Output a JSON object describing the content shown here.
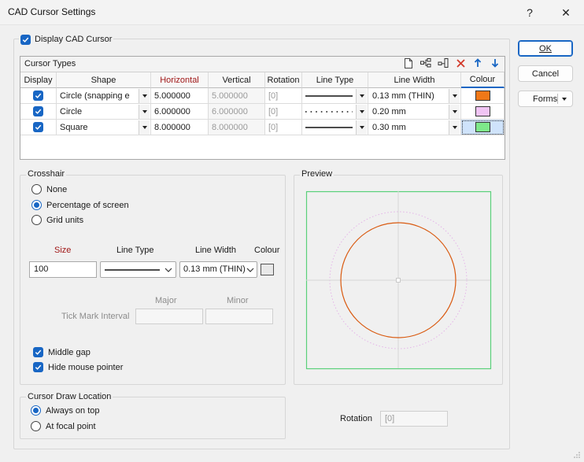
{
  "window": {
    "title": "CAD Cursor Settings",
    "help": "?",
    "close": "✕"
  },
  "display_cad_cursor": {
    "label": "Display CAD Cursor",
    "checked": true
  },
  "cursor_types": {
    "title": "Cursor Types",
    "columns": [
      "Display",
      "Shape",
      "Horizontal",
      "Vertical",
      "Rotation",
      "Line Type",
      "Line Width",
      "Colour"
    ],
    "rows": [
      {
        "display": true,
        "shape": "Circle (snapping e",
        "horizontal": "5.000000",
        "vertical": "5.000000",
        "rotation": "[0]",
        "line_type": "solid",
        "line_width": "0.13 mm (THIN)",
        "colour": "#f07818"
      },
      {
        "display": true,
        "shape": "Circle",
        "horizontal": "6.000000",
        "vertical": "6.000000",
        "rotation": "[0]",
        "line_type": "dotted",
        "line_width": "0.20 mm",
        "colour": "#f0c4f4"
      },
      {
        "display": true,
        "shape": "Square",
        "horizontal": "8.000000",
        "vertical": "8.000000",
        "rotation": "[0]",
        "line_type": "solid",
        "line_width": "0.30 mm",
        "colour": "#7ee88a"
      }
    ]
  },
  "crosshair": {
    "title": "Crosshair",
    "options": [
      "None",
      "Percentage of screen",
      "Grid units"
    ],
    "selected": "Percentage of screen",
    "size_label": "Size",
    "line_type_label": "Line Type",
    "line_width_label": "Line Width",
    "colour_label": "Colour",
    "size_value": "100",
    "line_width_value": "0.13 mm (THIN)",
    "tick_label": "Tick Mark Interval",
    "major_label": "Major",
    "minor_label": "Minor",
    "middle_gap": "Middle gap",
    "hide_mouse": "Hide mouse pointer"
  },
  "draw_location": {
    "title": "Cursor Draw Location",
    "options": [
      "Always on top",
      "At focal point"
    ],
    "selected": "Always on top"
  },
  "preview": {
    "title": "Preview"
  },
  "rotation": {
    "label": "Rotation",
    "value": "[0]"
  },
  "buttons": {
    "ok": "OK",
    "cancel": "Cancel",
    "forms": "Forms"
  },
  "colors": {
    "accent": "#1866c4",
    "header_red": "#a01818",
    "preview_circle": "#d95a10",
    "preview_box": "#5ad07a"
  }
}
